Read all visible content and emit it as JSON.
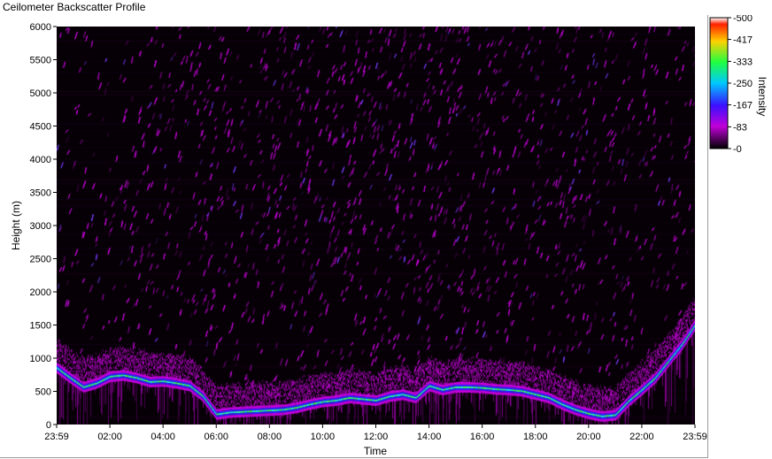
{
  "chart_data": {
    "type": "heatmap",
    "title": "Ceilometer Backscatter Profile",
    "xlabel": "Time",
    "ylabel": "Height (m)",
    "x_ticks": [
      "23:59",
      "02:00",
      "04:00",
      "06:00",
      "08:00",
      "10:00",
      "12:00",
      "14:00",
      "16:00",
      "18:00",
      "20:00",
      "22:00",
      "23:59"
    ],
    "y_ticks": [
      0,
      500,
      1000,
      1500,
      2000,
      2500,
      3000,
      3500,
      4000,
      4500,
      5000,
      5500,
      6000
    ],
    "ylim": [
      0,
      6000
    ],
    "colorbar": {
      "label": "Intensity",
      "ticks": [
        0,
        83,
        167,
        250,
        333,
        417,
        500
      ],
      "range": [
        0,
        500
      ]
    },
    "cloud_base_profile": {
      "time_hours": [
        0,
        0.5,
        1,
        1.5,
        2,
        2.5,
        3,
        3.5,
        4,
        4.5,
        5,
        5.5,
        6,
        6.5,
        7,
        7.5,
        8,
        8.5,
        9,
        9.5,
        10,
        10.5,
        11,
        11.5,
        12,
        12.5,
        13,
        13.5,
        14,
        14.5,
        15,
        15.5,
        16,
        16.5,
        17,
        17.5,
        18,
        18.5,
        19,
        19.5,
        20,
        20.5,
        21,
        21.5,
        22,
        22.5,
        23,
        23.5,
        24
      ],
      "height_m": [
        850,
        700,
        560,
        620,
        720,
        740,
        700,
        640,
        650,
        620,
        580,
        420,
        150,
        180,
        190,
        200,
        210,
        220,
        250,
        300,
        340,
        360,
        400,
        380,
        360,
        420,
        450,
        400,
        580,
        520,
        560,
        560,
        550,
        530,
        520,
        500,
        450,
        400,
        300,
        220,
        160,
        120,
        140,
        350,
        520,
        700,
        950,
        1200,
        1500
      ]
    },
    "colors": {
      "background": "#060006",
      "magenta": "#c000d8",
      "blue": "#2a1cff",
      "cyan": "#20e8d8",
      "green": "#40ff40"
    }
  }
}
